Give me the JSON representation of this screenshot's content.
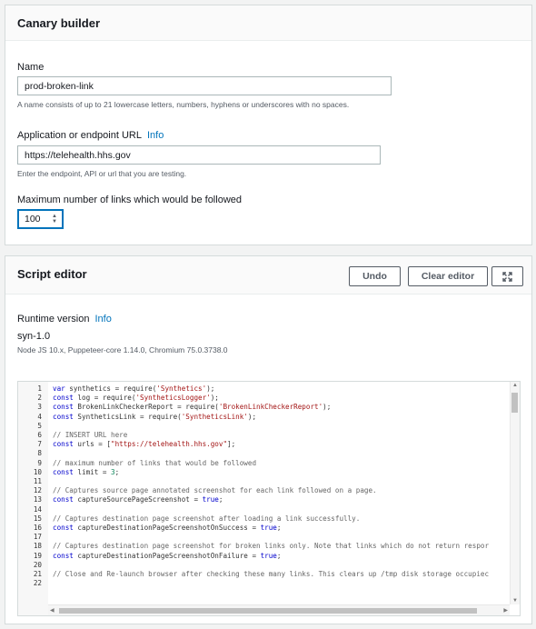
{
  "canary_builder": {
    "title": "Canary builder",
    "name_label": "Name",
    "name_value": "prod-broken-link",
    "name_hint": "A name consists of up to 21 lowercase letters, numbers, hyphens or underscores with no spaces.",
    "url_label": "Application or endpoint URL",
    "url_info": "Info",
    "url_value": "https://telehealth.hhs.gov",
    "url_hint": "Enter the endpoint, API or url that you are testing.",
    "max_links_label": "Maximum number of links which would be followed",
    "max_links_value": "100"
  },
  "script_editor": {
    "title": "Script editor",
    "undo_label": "Undo",
    "clear_label": "Clear editor",
    "expand_icon": "expand-icon",
    "runtime_label": "Runtime version",
    "runtime_info": "Info",
    "runtime_value": "syn-1.0",
    "runtime_detail": "Node JS 10.x, Puppeteer-core 1.14.0, Chromium 75.0.3738.0",
    "lines": [
      {
        "n": "1",
        "code": "var synthetics = require('Synthetics');"
      },
      {
        "n": "2",
        "code": "const log = require('SyntheticsLogger');"
      },
      {
        "n": "3",
        "code": "const BrokenLinkCheckerReport = require('BrokenLinkCheckerReport');"
      },
      {
        "n": "4",
        "code": "const SyntheticsLink = require('SyntheticsLink');"
      },
      {
        "n": "5",
        "code": ""
      },
      {
        "n": "6",
        "code": "// INSERT URL here"
      },
      {
        "n": "7",
        "code": "const urls = [\"https://telehealth.hhs.gov\"];"
      },
      {
        "n": "8",
        "code": ""
      },
      {
        "n": "9",
        "code": "// maximum number of links that would be followed"
      },
      {
        "n": "10",
        "code": "const limit = 3;"
      },
      {
        "n": "11",
        "code": ""
      },
      {
        "n": "12",
        "code": "// Captures source page annotated screenshot for each link followed on a page."
      },
      {
        "n": "13",
        "code": "const captureSourcePageScreenshot = true;"
      },
      {
        "n": "14",
        "code": ""
      },
      {
        "n": "15",
        "code": "// Captures destination page screenshot after loading a link successfully."
      },
      {
        "n": "16",
        "code": "const captureDestinationPageScreenshotOnSuccess = true;"
      },
      {
        "n": "17",
        "code": ""
      },
      {
        "n": "18",
        "code": "// Captures destination page screenshot for broken links only. Note that links which do not return respor"
      },
      {
        "n": "19",
        "code": "const captureDestinationPageScreenshotOnFailure = true;"
      },
      {
        "n": "20",
        "code": ""
      },
      {
        "n": "21",
        "code": "// Close and Re-launch browser after checking these many links. This clears up /tmp disk storage occupiec"
      },
      {
        "n": "22",
        "code": ""
      }
    ]
  }
}
